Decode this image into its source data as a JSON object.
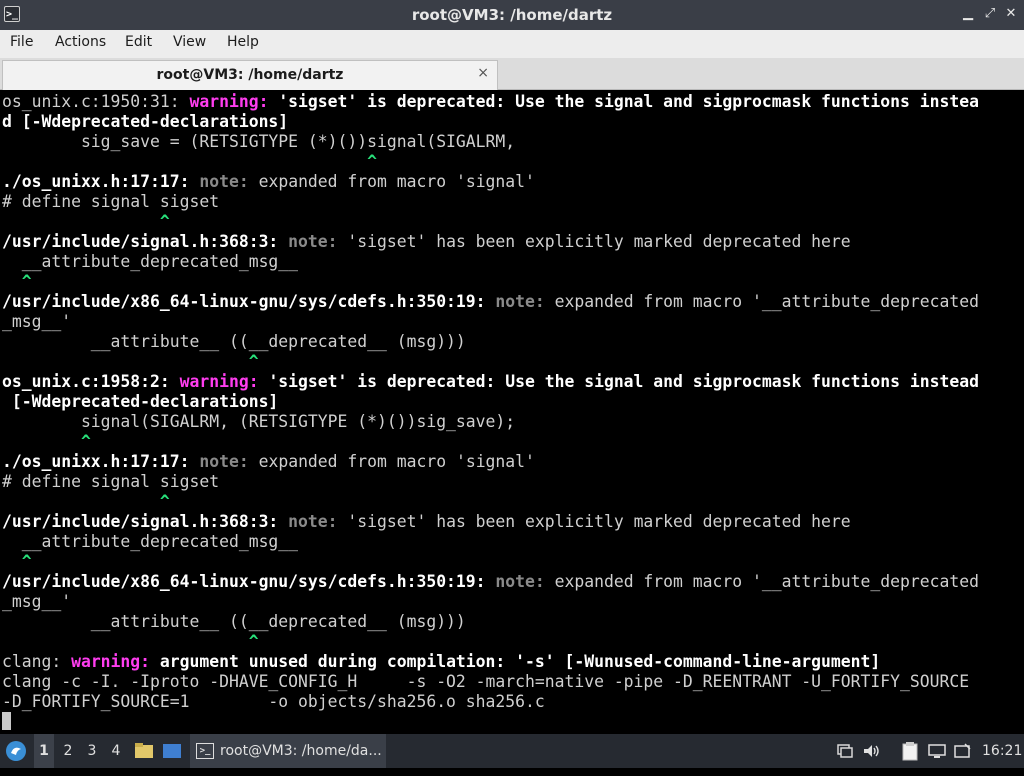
{
  "window": {
    "title": "root@VM3: /home/dartz",
    "icon": "terminal-icon"
  },
  "menubar": [
    "File",
    "Actions",
    "Edit",
    "View",
    "Help"
  ],
  "tab": {
    "label": "root@VM3: /home/dartz",
    "close": "×"
  },
  "terminal": {
    "lines": [
      [
        [
          "",
          "os_unix.c:1950:31: "
        ],
        [
          "w",
          "warning: "
        ],
        [
          "b",
          "'sigset' is deprecated: Use the signal and sigprocmask functions instea"
        ]
      ],
      [
        [
          "b",
          "d [-Wdeprecated-declarations]"
        ]
      ],
      [
        [
          "",
          "        sig_save = (RETSIGTYPE (*)())signal(SIGALRM,"
        ]
      ],
      [
        [
          "g",
          "                                     ^"
        ]
      ],
      [
        [
          "b",
          "./os_unixx.h:17:17: "
        ],
        [
          "n",
          "note: "
        ],
        [
          "",
          "expanded from macro 'signal'"
        ]
      ],
      [
        [
          "",
          "# define signal sigset"
        ]
      ],
      [
        [
          "g",
          "                ^"
        ]
      ],
      [
        [
          "b",
          "/usr/include/signal.h:368:3: "
        ],
        [
          "n",
          "note: "
        ],
        [
          "",
          "'sigset' has been explicitly marked deprecated here"
        ]
      ],
      [
        [
          "",
          "  __attribute_deprecated_msg__"
        ]
      ],
      [
        [
          "g",
          "  ^"
        ]
      ],
      [
        [
          "b",
          "/usr/include/x86_64-linux-gnu/sys/cdefs.h:350:19: "
        ],
        [
          "n",
          "note: "
        ],
        [
          "",
          "expanded from macro '__attribute_deprecated"
        ]
      ],
      [
        [
          "",
          "_msg__'"
        ]
      ],
      [
        [
          "",
          "         __attribute__ ((__deprecated__ (msg)))"
        ]
      ],
      [
        [
          "g",
          "                         ^"
        ]
      ],
      [
        [
          "b",
          "os_unix.c:1958:2: "
        ],
        [
          "w",
          "warning: "
        ],
        [
          "b",
          "'sigset' is deprecated: Use the signal and sigprocmask functions instead"
        ]
      ],
      [
        [
          "b",
          " [-Wdeprecated-declarations]"
        ]
      ],
      [
        [
          "",
          "        signal(SIGALRM, (RETSIGTYPE (*)())sig_save);"
        ]
      ],
      [
        [
          "g",
          "        ^"
        ]
      ],
      [
        [
          "b",
          "./os_unixx.h:17:17: "
        ],
        [
          "n",
          "note: "
        ],
        [
          "",
          "expanded from macro 'signal'"
        ]
      ],
      [
        [
          "",
          "# define signal sigset"
        ]
      ],
      [
        [
          "g",
          "                ^"
        ]
      ],
      [
        [
          "b",
          "/usr/include/signal.h:368:3: "
        ],
        [
          "n",
          "note: "
        ],
        [
          "",
          "'sigset' has been explicitly marked deprecated here"
        ]
      ],
      [
        [
          "",
          "  __attribute_deprecated_msg__"
        ]
      ],
      [
        [
          "g",
          "  ^"
        ]
      ],
      [
        [
          "b",
          "/usr/include/x86_64-linux-gnu/sys/cdefs.h:350:19: "
        ],
        [
          "n",
          "note: "
        ],
        [
          "",
          "expanded from macro '__attribute_deprecated"
        ]
      ],
      [
        [
          "",
          "_msg__'"
        ]
      ],
      [
        [
          "",
          "         __attribute__ ((__deprecated__ (msg)))"
        ]
      ],
      [
        [
          "g",
          "                         ^"
        ]
      ],
      [
        [
          "",
          "clang: "
        ],
        [
          "w",
          "warning: "
        ],
        [
          "b",
          "argument unused during compilation: '-s' [-Wunused-command-line-argument]"
        ]
      ],
      [
        [
          "",
          "clang -c -I. -Iproto -DHAVE_CONFIG_H     -s -O2 -march=native -pipe -D_REENTRANT -U_FORTIFY_SOURCE"
        ]
      ],
      [
        [
          "",
          "-D_FORTIFY_SOURCE=1        -o objects/sha256.o sha256.c"
        ]
      ]
    ]
  },
  "taskbar": {
    "workspaces": [
      "1",
      "2",
      "3",
      "4"
    ],
    "task_label": "root@VM3: /home/da...",
    "clock": "16:21"
  },
  "colors": {
    "warning": "#ff3df0",
    "note": "#8a8a8a",
    "caret": "#28e07a",
    "bold": "#ffffff",
    "normal": "#d0d0d0"
  }
}
